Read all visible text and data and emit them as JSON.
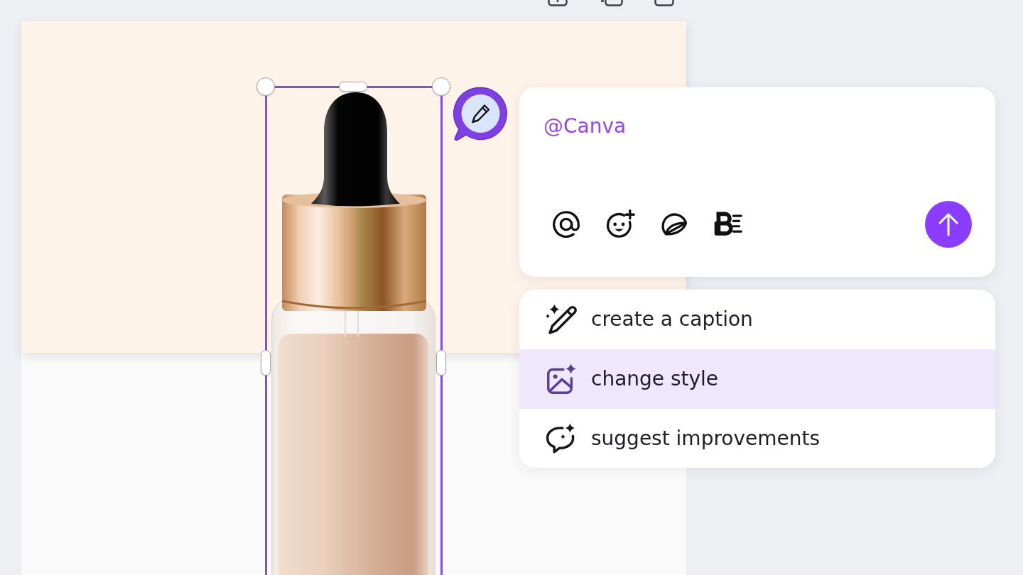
{
  "prompt": {
    "value": "@Canva"
  },
  "suggestions": [
    {
      "label": "create a caption",
      "kind": "caption",
      "selected": false
    },
    {
      "label": "change style",
      "kind": "style",
      "selected": true
    },
    {
      "label": "suggest improvements",
      "kind": "improve",
      "selected": false
    }
  ]
}
